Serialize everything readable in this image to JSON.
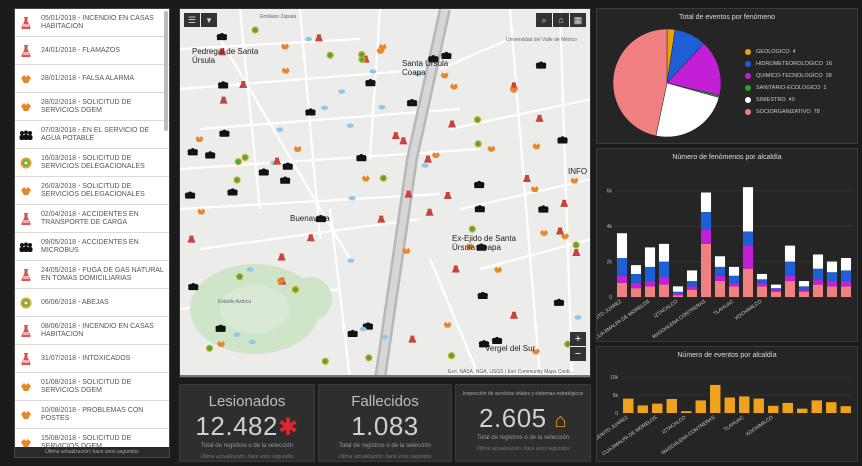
{
  "events_list": {
    "items": [
      {
        "label": "05/01/2018 - INCENDIO EN CASAS HABITACION",
        "icon": "flask-icon",
        "color": "#d9534f"
      },
      {
        "label": "24/01/2018 - FLAMAZOS",
        "icon": "flask-icon",
        "color": "#d9534f"
      },
      {
        "label": "28/01/2018 - FALSA ALARMA",
        "icon": "hands-icon",
        "color": "#e8862a"
      },
      {
        "label": "28/02/2018 - SOLICITUD DE SERVICIOS DGEM",
        "icon": "hands-icon",
        "color": "#e8862a"
      },
      {
        "label": "07/03/2018 - EN EL SERVICIO DE AGUA POTABLE",
        "icon": "crowd-icon",
        "color": "#111111"
      },
      {
        "label": "16/03/2018 - SOLICITUD DE SERVICIOS DELEGACIONALES",
        "icon": "sanitary-icon",
        "color": "#6aa84f"
      },
      {
        "label": "26/03/2018 - SOLICITUD DE SERVICIOS DELEGACIONALES",
        "icon": "hands-icon",
        "color": "#e8862a"
      },
      {
        "label": "02/04/2018 - ACCIDENTES EN TRANSPORTE DE CARGA",
        "icon": "flask-icon",
        "color": "#d9534f"
      },
      {
        "label": "09/05/2018 - ACCIDENTES EN MICROBUS",
        "icon": "crowd-icon",
        "color": "#111111"
      },
      {
        "label": "24/05/2018 - FUGA DE GAS NATURAL EN TOMAS DOMICILIARIAS",
        "icon": "flask-icon",
        "color": "#d9534f"
      },
      {
        "label": "06/06/2018 - ABEJAS",
        "icon": "sanitary-icon",
        "color": "#6aa84f"
      },
      {
        "label": "08/06/2018 - INCENDIO EN CASAS HABITACION",
        "icon": "flask-icon",
        "color": "#d9534f"
      },
      {
        "label": "31/07/2018 - INTOXICADOS",
        "icon": "flask-icon",
        "color": "#d9534f"
      },
      {
        "label": "01/08/2018 - SOLICITUD DE SERVICIOS DGEM",
        "icon": "hands-icon",
        "color": "#e8862a"
      },
      {
        "label": "10/08/2018 - PROBLEMAS CON POSTES",
        "icon": "hands-icon",
        "color": "#e8862a"
      },
      {
        "label": "15/08/2018 - SOLICITUD DE SERVICIOS DGEM",
        "icon": "hands-icon",
        "color": "#e8862a"
      }
    ],
    "footer": "Última actualización: hace unos segundos"
  },
  "map": {
    "labels": [
      {
        "text": "Emiliano Zapata",
        "cls": "small"
      },
      {
        "text": "Pedregal de Santa Úrsula",
        "cls": "bold"
      },
      {
        "text": "Santa Úrsula Coapa",
        "cls": "bold"
      },
      {
        "text": "Universidad del Valle de México",
        "cls": "small"
      },
      {
        "text": "Buenavista",
        "cls": "bold"
      },
      {
        "text": "Ex-Ejido de Santa Úrsula Coapa",
        "cls": "bold"
      },
      {
        "text": "Estadio Azteca",
        "cls": "small"
      },
      {
        "text": "Vergel del Sur",
        "cls": "bold"
      },
      {
        "text": "INFO",
        "cls": "bold"
      }
    ],
    "attribution": "Esri, NASA, NGA, USGS | Esri Community Maps Contr...",
    "zoom_in": "+",
    "zoom_out": "−"
  },
  "kpis": {
    "lesionados": {
      "title": "Lesionados",
      "value": "12.482",
      "subtitle": "Total de registros o de la selección",
      "footer": "Última actualización: hace unos segundos"
    },
    "fallecidos": {
      "title": "Fallecidos",
      "value": "1.083",
      "subtitle": "Total de registros o de la selección",
      "footer": "Última actualización: hace unos segundos"
    },
    "inmuebles": {
      "title": "Inspección de servicios vitales y sistemas estratégicos",
      "value": "2.605",
      "subtitle": "Total de registros o de la selección",
      "footer": "Última actualización: hace unos segundos"
    }
  },
  "chart_data": [
    {
      "type": "pie",
      "title": "Total de eventos por fenómeno",
      "slices": [
        {
          "name": "GEOLOGICO",
          "value": 4,
          "color": "#e8a20c"
        },
        {
          "name": "HIDROMETEOROLOGICO",
          "value": 16,
          "color": "#1f5fd6"
        },
        {
          "name": "QUIMICO-TECNOLOGICO",
          "value": 28,
          "color": "#c21fd6"
        },
        {
          "name": "SANITARIO-ECOLOGICO",
          "value": 1,
          "color": "#27a12a"
        },
        {
          "name": "SINIESTRO",
          "value": 40,
          "color": "#ffffff"
        },
        {
          "name": "SOCIORGANIZATIVO",
          "value": 78,
          "color": "#f08080"
        }
      ],
      "legend_position": "right"
    },
    {
      "type": "bar",
      "stacked": true,
      "title": "Número de fenómenos por alcaldía",
      "ylim": [
        0,
        7000
      ],
      "yticks": [
        "0",
        "2k",
        "4k",
        "6k"
      ],
      "categories": [
        "BENITO JUAREZ",
        "",
        "CUAJIMALPA DE MORELOS",
        "",
        "IZTACALCO",
        "",
        "MAGDALENA CONTRERAS",
        "",
        "TLAHUAC",
        "",
        "XOCHIMILCO",
        "",
        "",
        "",
        "",
        "",
        ""
      ],
      "series": [
        {
          "color": "#f08080",
          "values": [
            800,
            500,
            600,
            700,
            100,
            400,
            3000,
            900,
            600,
            1600,
            600,
            300,
            900,
            300,
            700,
            600,
            600
          ]
        },
        {
          "color": "#c21fd6",
          "values": [
            400,
            300,
            300,
            400,
            100,
            200,
            800,
            300,
            200,
            1300,
            200,
            100,
            300,
            100,
            300,
            300,
            300
          ]
        },
        {
          "color": "#1f5fd6",
          "values": [
            1000,
            500,
            800,
            900,
            100,
            300,
            1000,
            500,
            400,
            800,
            200,
            100,
            800,
            200,
            600,
            500,
            600
          ]
        },
        {
          "color": "#ffffff",
          "values": [
            1400,
            500,
            1100,
            1000,
            300,
            600,
            1100,
            600,
            500,
            2500,
            300,
            200,
            900,
            300,
            800,
            600,
            700
          ]
        }
      ]
    },
    {
      "type": "bar",
      "title": "Número de eventos por alcaldía",
      "ylim": [
        0,
        10000
      ],
      "yticks": [
        "0",
        "5k",
        "10k"
      ],
      "categories": [
        "BENITO JUAREZ",
        "",
        "CUAJIMALPA DE MORELOS",
        "",
        "IZTACALCO",
        "",
        "MAGDALENA CONTRERAS",
        "",
        "TLAHUAC",
        "",
        "XOCHIMILCO",
        "",
        "",
        "",
        "",
        ""
      ],
      "series": [
        {
          "color": "#f0a21c",
          "values": [
            4000,
            2100,
            2600,
            3900,
            500,
            3500,
            7800,
            4300,
            4600,
            4000,
            2000,
            2800,
            1200,
            3500,
            3000,
            1900
          ]
        }
      ]
    }
  ]
}
